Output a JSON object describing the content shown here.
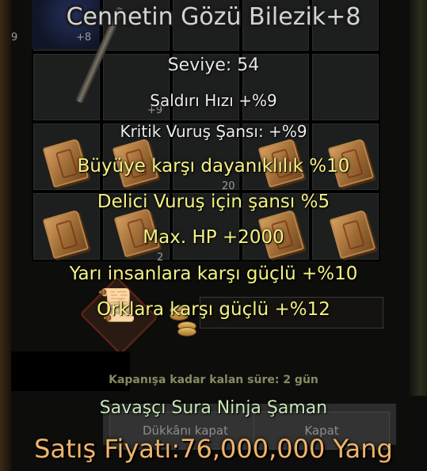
{
  "item": {
    "name": "Cennetin Gözü Bilezik+8",
    "level": "Seviye: 54",
    "stats": [
      "Saldırı Hızı +%9",
      "Kritik Vuruş Şansı: +%9"
    ],
    "bonuses": [
      "Büyüye karşı dayanıklılık %10",
      "Delici Vuruş için şansı %5",
      "Max. HP +2000",
      "Yarı insanlara karşı güçlü +%10",
      "Orklara karşı güçlü +%12"
    ],
    "remaining": "Kapanışa kadar kalan süre: 2 gün",
    "classes": "Savaşçı Sura Ninja Şaman",
    "price": "Satış Fiyatı:76,000,000 Yang"
  },
  "inventory": {
    "count_labels": [
      "9",
      "+8",
      "+9",
      "20",
      "2"
    ]
  },
  "buttons": {
    "close_shop": "Dükkânı kapat",
    "close": "Kapat"
  },
  "colors": {
    "bonus": "#f5f283",
    "price": "#f0b36a",
    "classes": "#c9e8b8"
  }
}
